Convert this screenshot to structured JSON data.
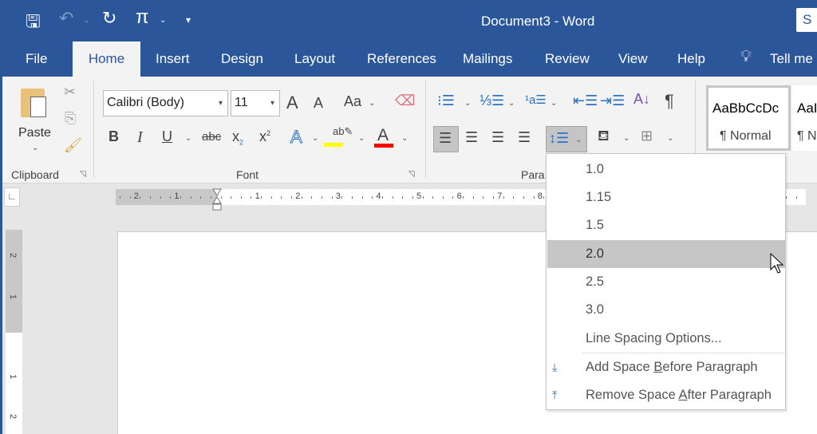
{
  "window": {
    "title": "Document3  -  Word",
    "signin_partial": "S"
  },
  "qat": {
    "save": "save-icon",
    "undo": "undo-icon",
    "redo": "redo-icon",
    "equation": "π",
    "customize": "customize-icon"
  },
  "tabs": [
    {
      "label": "File"
    },
    {
      "label": "Home",
      "active": true
    },
    {
      "label": "Insert"
    },
    {
      "label": "Design"
    },
    {
      "label": "Layout"
    },
    {
      "label": "References"
    },
    {
      "label": "Mailings"
    },
    {
      "label": "Review"
    },
    {
      "label": "View"
    },
    {
      "label": "Help"
    }
  ],
  "tell_me": "Tell me",
  "clipboard": {
    "paste": "Paste",
    "group": "Clipboard"
  },
  "font": {
    "name": "Calibri (Body)",
    "size": "11",
    "change_case": "Aa",
    "group": "Font",
    "highlight_color": "#ffff00",
    "font_color": "#ff0000"
  },
  "paragraph": {
    "group_partial": "Para"
  },
  "styles": [
    {
      "preview": "AaBbCcDc",
      "name": "¶ Normal"
    },
    {
      "preview": "AaI",
      "name": "¶ No"
    }
  ],
  "ruler": {
    "negative": [
      "2",
      "1"
    ],
    "positive": [
      "1",
      "2",
      "3",
      "4",
      "5",
      "6",
      "7",
      "8"
    ],
    "vertical_top": [
      "2",
      "1"
    ],
    "vertical_bottom": [
      "1",
      "2"
    ]
  },
  "line_spacing_menu": {
    "options": [
      "1.0",
      "1.15",
      "1.5",
      "2.0",
      "2.5",
      "3.0"
    ],
    "selected": "2.0",
    "more": "Line Spacing Options...",
    "add_before_pre": "Add Space ",
    "add_before_key": "B",
    "add_before_post": "efore Paragraph",
    "remove_after_pre": "Remove Space ",
    "remove_after_key": "A",
    "remove_after_post": "fter Paragraph"
  },
  "colors": {
    "title_bar": "#2b579a",
    "ribbon": "#f3f3f3",
    "accent_blue": "#2b579a"
  }
}
